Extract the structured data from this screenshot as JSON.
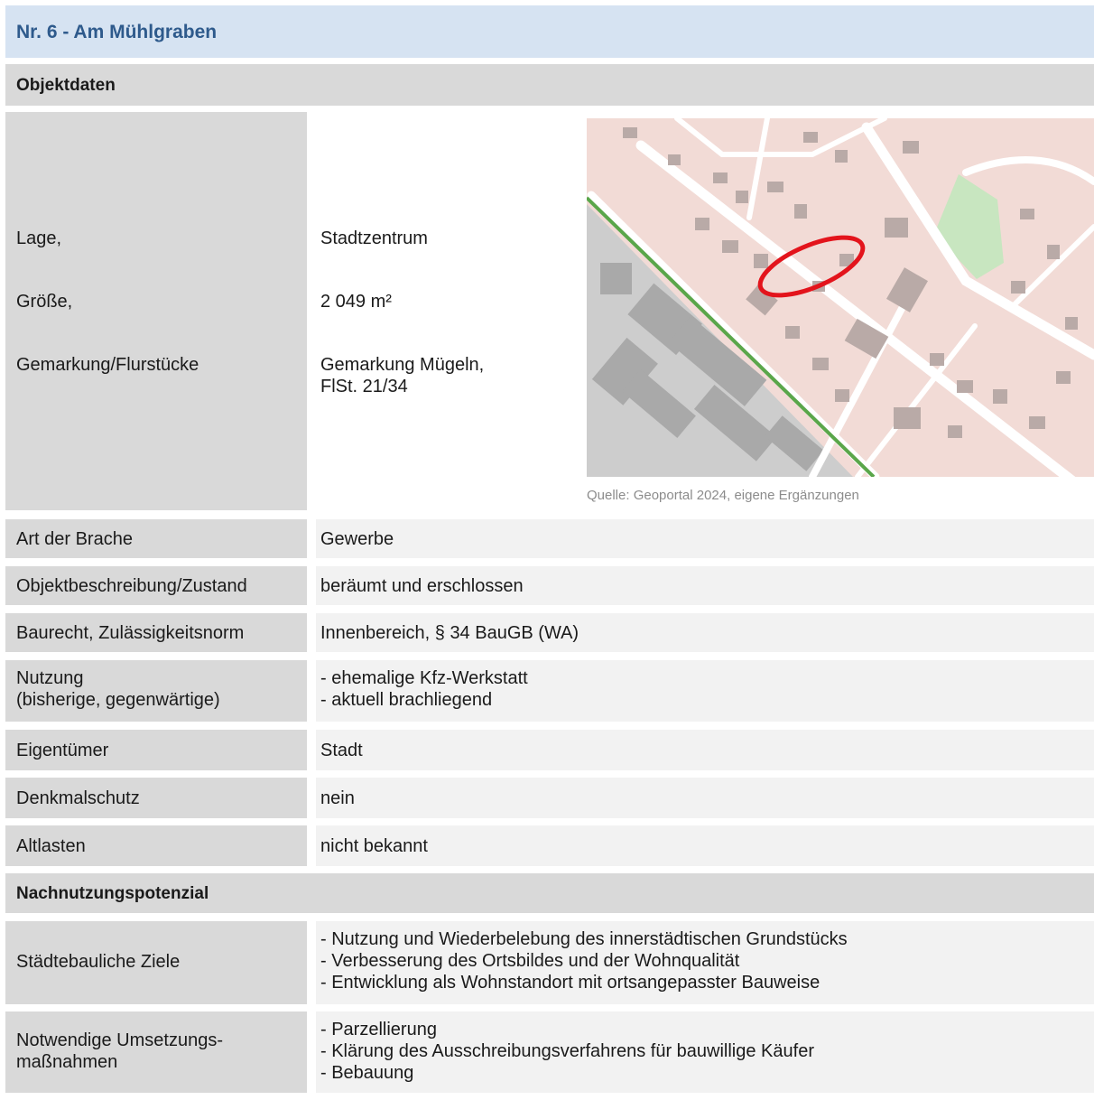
{
  "title": "Nr. 6 - Am Mühlgraben",
  "sections": {
    "objektdaten": "Objektdaten",
    "nachnutzung": "Nachnutzungspotenzial"
  },
  "location": {
    "labels": [
      "Lage,",
      "Größe,",
      "Gemarkung/Flurstücke"
    ],
    "values": [
      "Stadtzentrum",
      "2 049 m²",
      "Gemarkung Mügeln,",
      "FlSt. 21/34"
    ]
  },
  "map": {
    "caption": "Quelle: Geoportal 2024, eigene Ergänzungen",
    "colors": {
      "background": "#f2dbd6",
      "roads": "#ffffff",
      "buildings": "#b9aaa7",
      "industrial": "#cdcdcd",
      "industrial_buildings": "#a9a9a9",
      "park": "#c8e6c0",
      "rail": "#5aa64a",
      "marker": "#e3141c"
    }
  },
  "rows": [
    {
      "label": "Art der Brache",
      "value": "Gewerbe"
    },
    {
      "label": "Objektbeschreibung/Zustand",
      "value": "beräumt und erschlossen"
    },
    {
      "label": "Baurecht, Zulässigkeitsnorm",
      "value": "Innenbereich, § 34 BauGB (WA)"
    },
    {
      "label": [
        "Nutzung",
        "(bisherige, gegenwärtige)"
      ],
      "value": [
        "-  ehemalige Kfz-Werkstatt",
        "-  aktuell brachliegend"
      ]
    },
    {
      "label": "Eigentümer",
      "value": "Stadt"
    },
    {
      "label": "Denkmalschutz",
      "value": "nein"
    },
    {
      "label": "Altlasten",
      "value": "nicht bekannt"
    }
  ],
  "potential": [
    {
      "label": "Städtebauliche Ziele",
      "items": [
        "-  Nutzung und Wiederbelebung des innerstädtischen Grundstücks",
        "-  Verbesserung des Ortsbildes und der Wohnqualität",
        "-  Entwicklung als Wohnstandort mit ortsangepasster Bauweise"
      ]
    },
    {
      "label": [
        "Notwendige Umsetzungs-",
        "maßnahmen"
      ],
      "items": [
        "-  Parzellierung",
        "-  Klärung des Ausschreibungsverfahrens für bauwillige Käufer",
        "-  Bebauung"
      ]
    }
  ]
}
